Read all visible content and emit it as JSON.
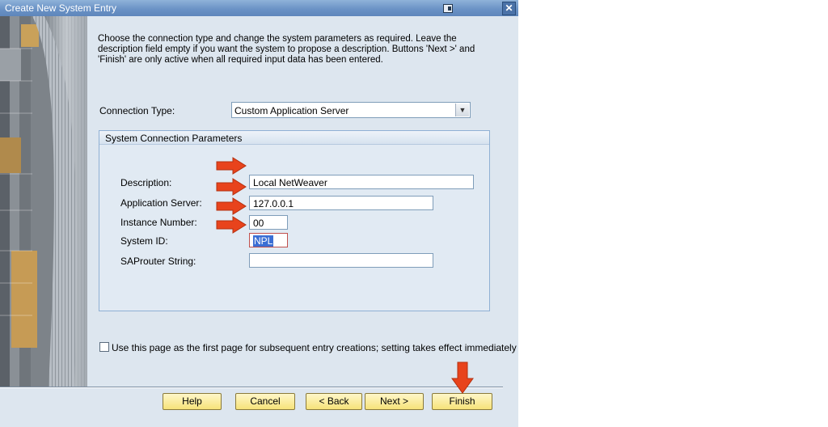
{
  "window": {
    "title": "Create New System Entry"
  },
  "intro_text": "Choose the connection type and change the system parameters as required. Leave the description field empty if you want the system to propose a description. Buttons 'Next >' and 'Finish' are only active when all required input data has been entered.",
  "connection": {
    "label": "Connection Type:",
    "selected": "Custom Application Server"
  },
  "group": {
    "title": "System Connection Parameters",
    "fields": [
      {
        "label": "Description:",
        "value": "Local NetWeaver"
      },
      {
        "label": "Application Server:",
        "value": "127.0.0.1"
      },
      {
        "label": "Instance Number:",
        "value": "00"
      },
      {
        "label": "System ID:",
        "value": "NPL"
      },
      {
        "label": "SAProuter String:",
        "value": ""
      }
    ]
  },
  "first_page_option": {
    "label": "Use this page as the first page for subsequent entry creations; setting takes effect immediately",
    "checked": false
  },
  "buttons": {
    "help": "Help",
    "cancel": "Cancel",
    "back": "< Back",
    "next": "Next >",
    "finish": "Finish"
  },
  "colors": {
    "annotation_arrow": "#e8431c",
    "button_bg": "#f6e27a",
    "titlebar": "#6b93c6"
  },
  "icons": {
    "restore": "restore-icon",
    "close": "close-icon",
    "dropdown": "chevron-down-icon"
  }
}
